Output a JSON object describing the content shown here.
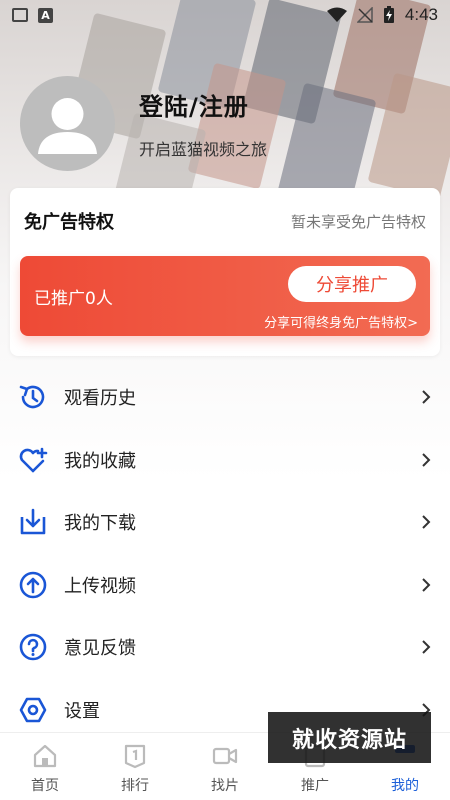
{
  "status_bar": {
    "time": "4:43",
    "notif_a": "A"
  },
  "profile": {
    "title": "登陆/注册",
    "subtitle": "开启蓝猫视频之旅"
  },
  "ad_card": {
    "title": "免广告特权",
    "status": "暂未享受免广告特权",
    "promo_count": "已推广0人",
    "share_button": "分享推广",
    "hint": "分享可得终身免广告特权>"
  },
  "menu": [
    {
      "label": "观看历史",
      "icon": "history-icon"
    },
    {
      "label": "我的收藏",
      "icon": "heart-plus-icon"
    },
    {
      "label": "我的下载",
      "icon": "download-icon"
    },
    {
      "label": "上传视频",
      "icon": "upload-icon"
    },
    {
      "label": "意见反馈",
      "icon": "feedback-icon"
    },
    {
      "label": "设置",
      "icon": "settings-icon"
    }
  ],
  "tabs": [
    {
      "label": "首页",
      "icon": "home-icon"
    },
    {
      "label": "排行",
      "icon": "ranking-icon"
    },
    {
      "label": "找片",
      "icon": "video-camera-icon"
    },
    {
      "label": "推广",
      "icon": "promote-icon"
    },
    {
      "label": "我的",
      "icon": "profile-icon",
      "active": true
    }
  ],
  "watermark": "就收资源站",
  "colors": {
    "accent": "#1c5fd8",
    "promo": "#ee4a36",
    "icon_blue": "#1a56d6"
  }
}
